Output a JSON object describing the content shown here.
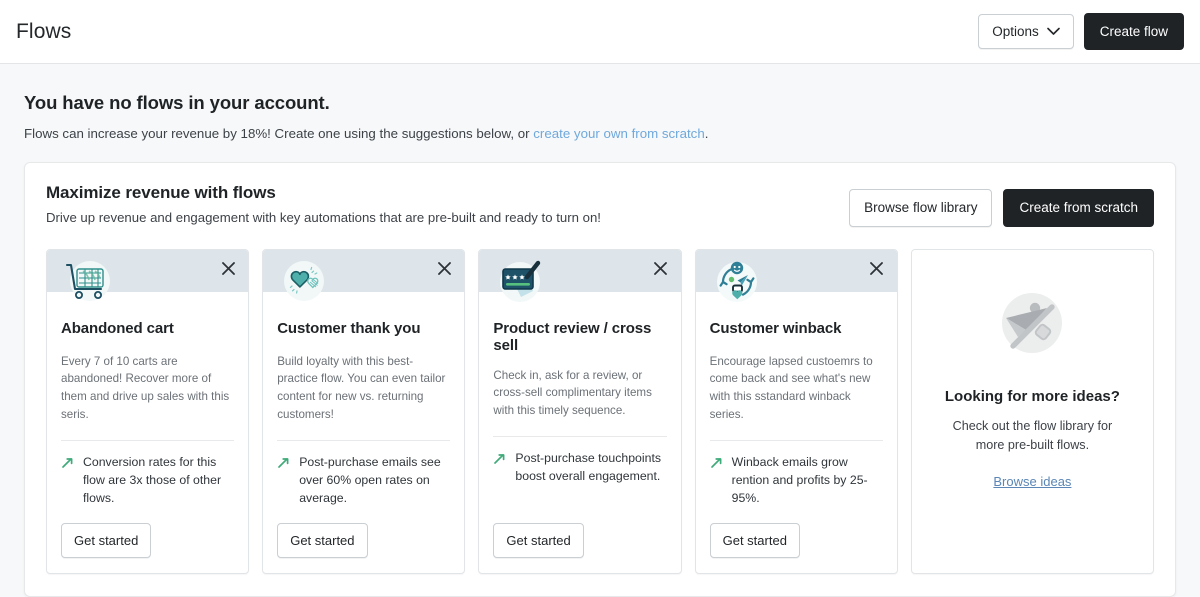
{
  "topbar": {
    "title": "Flows",
    "options_label": "Options",
    "options_icon": "chevron-down-icon",
    "create_flow_label": "Create flow"
  },
  "empty_state": {
    "title": "You have no flows in your account.",
    "text_before_link": "Flows can increase your revenue by 18%! Create one using the suggestions below, or ",
    "link_label": "create your own from scratch",
    "text_after_link": "."
  },
  "panel": {
    "title": "Maximize revenue with flows",
    "subtitle": "Drive up revenue and engagement with key automations that are pre-built and ready to turn on!",
    "browse_library_label": "Browse flow library",
    "create_from_scratch_label": "Create from scratch"
  },
  "cards": [
    {
      "icon": "shopping-cart-icon",
      "close_icon": "close-icon",
      "title": "Abandoned cart",
      "description": "Every 7 of 10 carts are abandoned! Recover more of them and drive up sales with this seris.",
      "stat_icon": "trend-up-arrow-icon",
      "stat": "Conversion rates for this flow are 3x those of other flows.",
      "cta_label": "Get started"
    },
    {
      "icon": "hearts-icon",
      "close_icon": "close-icon",
      "title": "Customer thank you",
      "description": "Build loyalty with this best-practice flow. You can even tailor content for new vs. returning customers!",
      "stat_icon": "trend-up-arrow-icon",
      "stat": "Post-purchase emails see over 60% open rates on average.",
      "cta_label": "Get started"
    },
    {
      "icon": "review-stars-icon",
      "close_icon": "close-icon",
      "title": "Product review / cross sell",
      "description": "Check in, ask for a review, or cross-sell complimentary items with this timely sequence.",
      "stat_icon": "trend-up-arrow-icon",
      "stat": "Post-purchase touchpoints boost overall engagement.",
      "cta_label": "Get started"
    },
    {
      "icon": "winback-cycle-icon",
      "close_icon": "close-icon",
      "title": "Customer winback",
      "description": "Encourage lapsed custoemrs to come back and see what's new with this sstandard winback series.",
      "stat_icon": "trend-up-arrow-icon",
      "stat": "Winback emails grow rention and profits by 25-95%.",
      "cta_label": "Get started"
    }
  ],
  "ideas_card": {
    "illustration_icon": "paper-plane-illustration-icon",
    "title": "Looking for more ideas?",
    "description": "Check out the flow library for more pre-built flows.",
    "link_label": "Browse ideas"
  },
  "colors": {
    "page_background": "#f7f8f9",
    "surface": "#ffffff",
    "card_band": "#dde5ea",
    "primary_button": "#1f2326",
    "link": "#6fa8dc",
    "ideas_link": "#5b86b5",
    "stat_arrow": "#3faa7a",
    "icon_teal": "#2f8f8c",
    "icon_navy": "#1d4f63"
  }
}
